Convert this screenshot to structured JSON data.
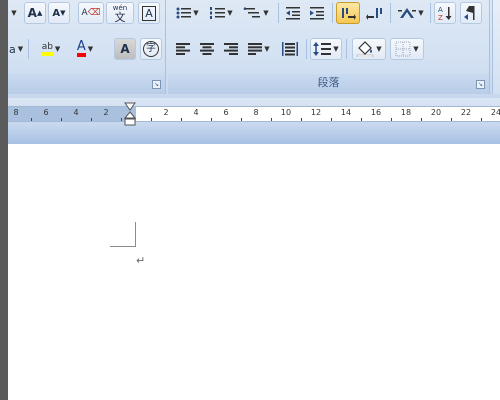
{
  "ribbon": {
    "font_group": {
      "grow_font": "A",
      "shrink_font": "A",
      "clear_format": "A",
      "phonetic_guide_top": "wén",
      "phonetic_guide_bottom": "文",
      "char_border": "A",
      "font_name_tail": "a",
      "highlight_color": "ab",
      "font_color": "A",
      "char_shading": "A",
      "enclose_char": "字"
    },
    "paragraph_group": {
      "label": "段落"
    }
  },
  "ruler": {
    "left_numbers": [
      "8",
      "6",
      "4",
      "2"
    ],
    "right_numbers": [
      "2",
      "4",
      "6",
      "8",
      "10",
      "12",
      "14",
      "16",
      "18",
      "20",
      "22",
      "24"
    ]
  },
  "document": {
    "paragraph_mark": "↵"
  },
  "colors": {
    "highlight": "#ffff00",
    "font_color": "#ff0000",
    "active_button": "#f6c752"
  }
}
